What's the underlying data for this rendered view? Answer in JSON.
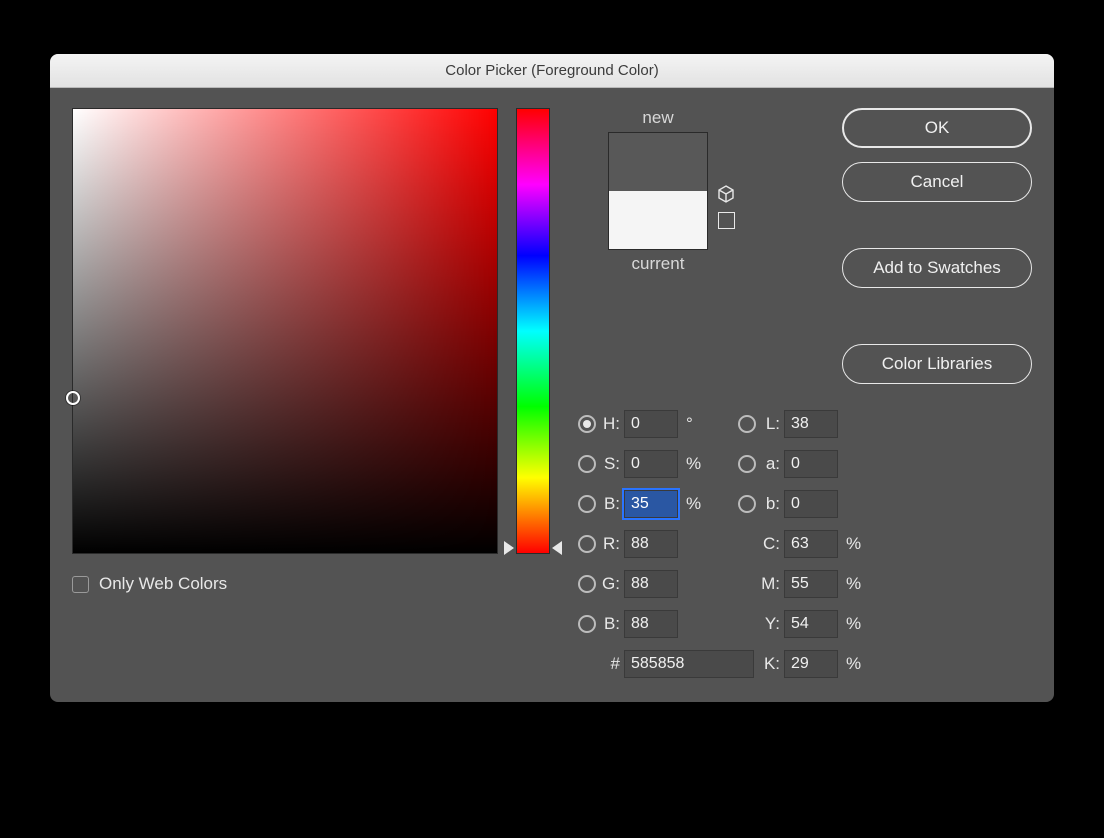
{
  "title": "Color Picker (Foreground Color)",
  "buttons": {
    "ok": "OK",
    "cancel": "Cancel",
    "add_swatches": "Add to Swatches",
    "color_libraries": "Color Libraries"
  },
  "preview": {
    "new_label": "new",
    "current_label": "current",
    "new_color": "#585858",
    "current_color": "#f5f5f5"
  },
  "only_web_colors_label": "Only Web Colors",
  "hue_selected": 0,
  "sv_cursor": {
    "s": 0,
    "b": 35
  },
  "fields": {
    "H": {
      "label": "H:",
      "value": "0",
      "unit": "°",
      "radio": true,
      "selected": true
    },
    "S": {
      "label": "S:",
      "value": "0",
      "unit": "%",
      "radio": true,
      "selected": false
    },
    "Bhsb": {
      "label": "B:",
      "value": "35",
      "unit": "%",
      "radio": true,
      "selected": false,
      "highlight": true
    },
    "R": {
      "label": "R:",
      "value": "88",
      "unit": "",
      "radio": true,
      "selected": false
    },
    "G": {
      "label": "G:",
      "value": "88",
      "unit": "",
      "radio": true,
      "selected": false
    },
    "Brgb": {
      "label": "B:",
      "value": "88",
      "unit": "",
      "radio": true,
      "selected": false
    },
    "L": {
      "label": "L:",
      "value": "38",
      "unit": "",
      "radio": true,
      "selected": false
    },
    "a": {
      "label": "a:",
      "value": "0",
      "unit": "",
      "radio": true,
      "selected": false
    },
    "b": {
      "label": "b:",
      "value": "0",
      "unit": "",
      "radio": true,
      "selected": false
    },
    "C": {
      "label": "C:",
      "value": "63",
      "unit": "%"
    },
    "M": {
      "label": "M:",
      "value": "55",
      "unit": "%"
    },
    "Y": {
      "label": "Y:",
      "value": "54",
      "unit": "%"
    },
    "K": {
      "label": "K:",
      "value": "29",
      "unit": "%"
    }
  },
  "hex": {
    "label": "#",
    "value": "585858"
  }
}
